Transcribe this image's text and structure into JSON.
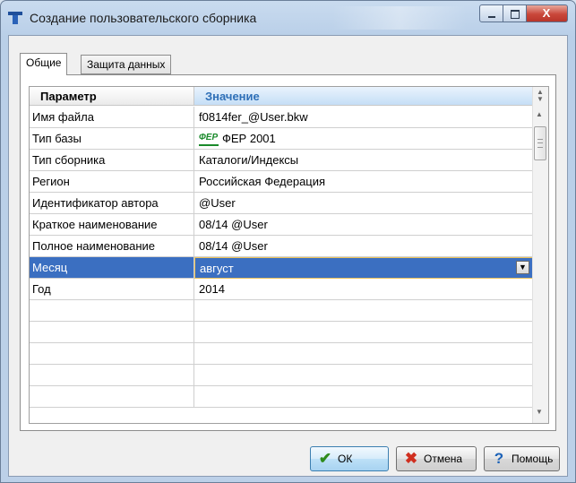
{
  "window": {
    "title": "Создание пользовательского сборника",
    "close_glyph": "X"
  },
  "tabs": [
    {
      "label": "Общие",
      "active": true
    },
    {
      "label": "Защита данных",
      "active": false
    }
  ],
  "grid": {
    "columns": {
      "param": "Параметр",
      "value": "Значение"
    },
    "rows": [
      {
        "param": "Имя файла",
        "value": "f0814fer_@User.bkw"
      },
      {
        "param": "Тип базы",
        "value": "ФЕР 2001",
        "icon": "fep-icon",
        "icon_text": "ФЕР"
      },
      {
        "param": "Тип сборника",
        "value": "Каталоги/Индексы"
      },
      {
        "param": "Регион",
        "value": "Российская Федерация"
      },
      {
        "param": "Идентификатор автора",
        "value": "@User"
      },
      {
        "param": "Краткое наименование",
        "value": "08/14 @User"
      },
      {
        "param": "Полное наименование",
        "value": "08/14 @User"
      },
      {
        "param": "Месяц",
        "value": "август",
        "selected": true
      },
      {
        "param": "Год",
        "value": "2014"
      }
    ]
  },
  "buttons": {
    "ok": "ОК",
    "cancel": "Отмена",
    "help": "Помощь"
  },
  "colors": {
    "selection": "#3b6fc1",
    "header_value_text": "#2e6fb7",
    "ok_icon": "#2e8b1c",
    "cancel_icon": "#d02f1f",
    "help_icon": "#1d63b8"
  }
}
